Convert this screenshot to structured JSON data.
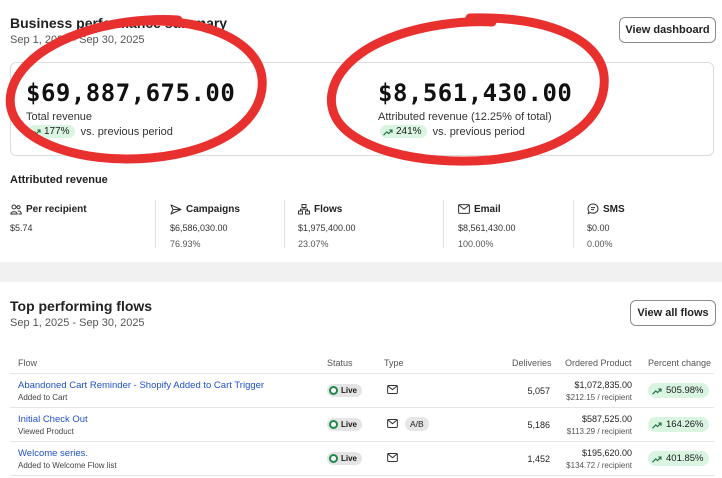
{
  "summary": {
    "title": "Business performance summary",
    "date_range": "Sep 1, 2025 - Sep 30, 2025",
    "view_dashboard_label": "View dashboard",
    "total_revenue": {
      "value": "$69,887,675.00",
      "label": "Total revenue",
      "change": "177%",
      "change_text": "vs. previous period"
    },
    "attributed_revenue": {
      "value": "$8,561,430.00",
      "label": "Attributed revenue (12.25% of total)",
      "change": "241%",
      "change_text": "vs. previous period"
    }
  },
  "attributed": {
    "title": "Attributed revenue",
    "metrics": [
      {
        "icon": "users-icon",
        "label": "Per recipient",
        "value": "$5.74",
        "percent": ""
      },
      {
        "icon": "send-icon",
        "label": "Campaigns",
        "value": "$6,586,030.00",
        "percent": "76.93%"
      },
      {
        "icon": "flow-icon",
        "label": "Flows",
        "value": "$1,975,400.00",
        "percent": "23.07%"
      },
      {
        "icon": "mail-icon",
        "label": "Email",
        "value": "$8,561,430.00",
        "percent": "100.00%"
      },
      {
        "icon": "sms-icon",
        "label": "SMS",
        "value": "$0.00",
        "percent": "0.00%"
      }
    ]
  },
  "flows": {
    "title": "Top performing flows",
    "date_range": "Sep 1, 2025 - Sep 30, 2025",
    "view_all_label": "View all flows",
    "columns": {
      "flow": "Flow",
      "status": "Status",
      "type": "Type",
      "deliveries": "Deliveries",
      "ordered": "Ordered Product",
      "change": "Percent change"
    },
    "rows": [
      {
        "name": "Abandoned Cart Reminder - Shopify Added to Cart Trigger",
        "trigger": "Added to Cart",
        "status": "Live",
        "ab": "",
        "deliveries": "5,057",
        "ordered": "$1,072,835.00",
        "per_recipient": "$212.15 / recipient",
        "change": "505.98%"
      },
      {
        "name": "Initial Check Out",
        "trigger": "Viewed Product",
        "status": "Live",
        "ab": "A/B",
        "deliveries": "5,186",
        "ordered": "$587,525.00",
        "per_recipient": "$113.29 / recipient",
        "change": "164.26%"
      },
      {
        "name": "Welcome series.",
        "trigger": "Added to Welcome Flow list",
        "status": "Live",
        "ab": "",
        "deliveries": "1,452",
        "ordered": "$195,620.00",
        "per_recipient": "$134.72 / recipient",
        "change": "401.85%"
      }
    ]
  },
  "colors": {
    "annotation_red": "#e8312f",
    "positive_green": "#d9f4e1",
    "link_blue": "#2051c9",
    "live_green": "#1e8a47"
  }
}
